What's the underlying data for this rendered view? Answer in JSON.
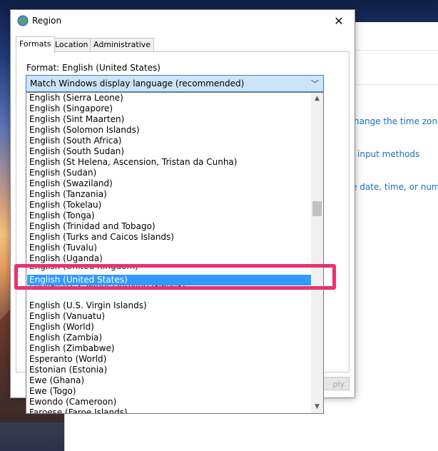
{
  "dialog": {
    "title": "Region",
    "close_label": "✕",
    "tabs": [
      {
        "label": "Formats"
      },
      {
        "label": "Location"
      },
      {
        "label": "Administrative"
      }
    ],
    "format_label": "Format: English (United States)",
    "apply_label": "ply"
  },
  "combobox": {
    "value": "Match Windows display language (recommended)",
    "arrow": "﹀"
  },
  "dropdown": {
    "items": [
      "English (Sierra Leone)",
      "English (Singapore)",
      "English (Sint Maarten)",
      "English (Solomon Islands)",
      "English (South Africa)",
      "English (South Sudan)",
      "English (St Helena, Ascension, Tristan da Cunha)",
      "English (Sudan)",
      "English (Swaziland)",
      "English (Tanzania)",
      "English (Tokelau)",
      "English (Tonga)",
      "English (Trinidad and Tobago)",
      "English (Turks and Caicos Islands)",
      "English (Tuvalu)",
      "English (Uganda)",
      "English (United Kingdom)",
      "English (United States)",
      "English (U.S. Minor Outlying Islands)",
      "English (U.S. Virgin Islands)",
      "English (Vanuatu)",
      "English (World)",
      "English (Zambia)",
      "English (Zimbabwe)",
      "Esperanto (World)",
      "Estonian (Estonia)",
      "Ewe (Ghana)",
      "Ewe (Togo)",
      "Ewondo (Cameroon)",
      "Faroese (Faroe Islands)"
    ],
    "selected": "English (United States)",
    "scroll_up": "▲",
    "scroll_down": "▼"
  },
  "background_window": {
    "links": [
      "hange the time zone",
      "input methods",
      "e date, time, or numbe"
    ]
  },
  "colors": {
    "accent": "#3399ff",
    "annotation": "#e8336b",
    "link": "#1a6ec2"
  }
}
